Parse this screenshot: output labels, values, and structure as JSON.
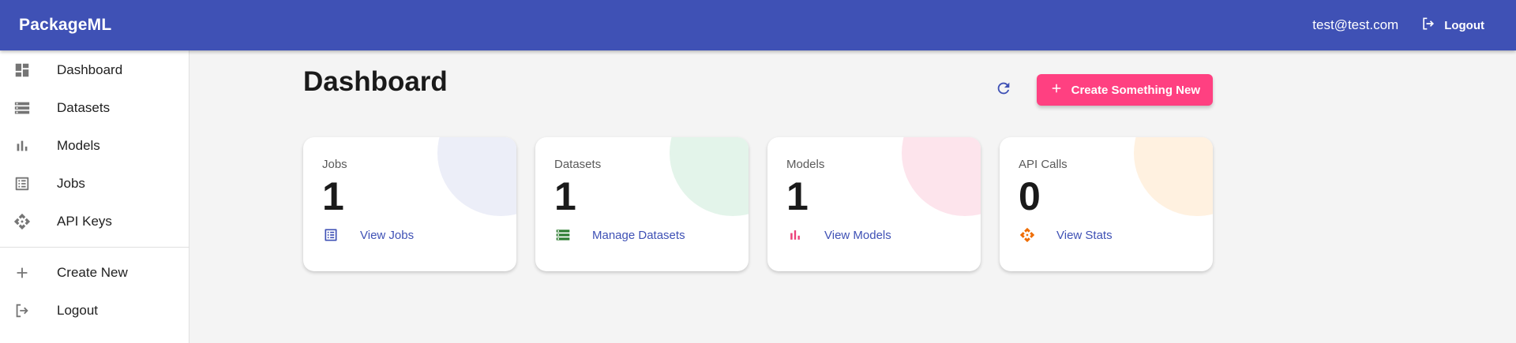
{
  "app": {
    "brand": "PackageML"
  },
  "topbar": {
    "user_email": "test@test.com",
    "logout_label": "Logout"
  },
  "sidebar": {
    "items": [
      {
        "label": "Dashboard",
        "icon": "dashboard-icon"
      },
      {
        "label": "Datasets",
        "icon": "storage-icon"
      },
      {
        "label": "Models",
        "icon": "bar-chart-icon"
      },
      {
        "label": "Jobs",
        "icon": "list-alt-icon"
      },
      {
        "label": "API Keys",
        "icon": "api-icon"
      }
    ],
    "secondary": [
      {
        "label": "Create New",
        "icon": "add-icon"
      },
      {
        "label": "Logout",
        "icon": "logout-icon"
      }
    ]
  },
  "main": {
    "title": "Dashboard",
    "create_button": "Create Something New",
    "cards": [
      {
        "title": "Jobs",
        "value": "1",
        "link": "View Jobs",
        "icon": "list-alt-icon",
        "accent": "#3f51b5",
        "blob": "#eceef8"
      },
      {
        "title": "Datasets",
        "value": "1",
        "link": "Manage Datasets",
        "icon": "storage-icon",
        "accent": "#2e7d32",
        "blob": "#e3f4ea"
      },
      {
        "title": "Models",
        "value": "1",
        "link": "View Models",
        "icon": "bar-chart-icon",
        "accent": "#ec407a",
        "blob": "#fde4ec"
      },
      {
        "title": "API Calls",
        "value": "0",
        "link": "View Stats",
        "icon": "api-icon",
        "accent": "#ef6c00",
        "blob": "#fff1e0"
      }
    ]
  },
  "colors": {
    "primary": "#3f51b5",
    "secondary": "#ff4081"
  }
}
